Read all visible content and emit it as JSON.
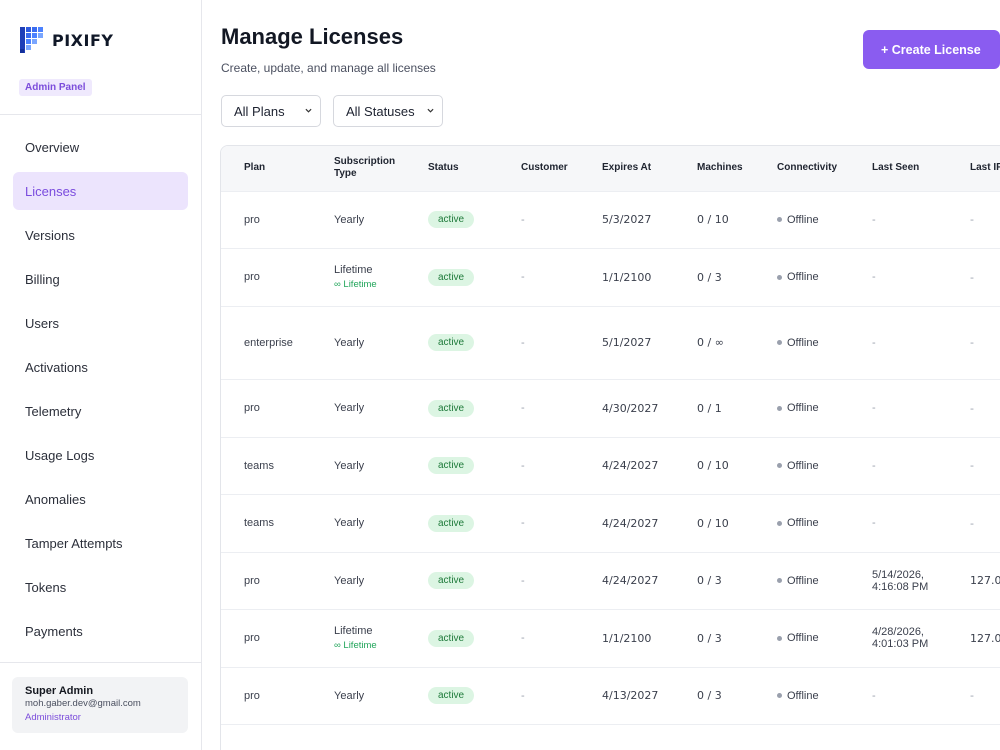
{
  "brand": {
    "name": "PIXIFY",
    "badge": "Admin Panel"
  },
  "nav": [
    "Overview",
    "Licenses",
    "Versions",
    "Billing",
    "Users",
    "Activations",
    "Telemetry",
    "Usage Logs",
    "Anomalies",
    "Tamper Attempts",
    "Tokens",
    "Payments"
  ],
  "active_nav": "Licenses",
  "user": {
    "name": "Super Admin",
    "email": "moh.gaber.dev@gmail.com",
    "role": "Administrator"
  },
  "header": {
    "title": "Manage Licenses",
    "subtitle": "Create, update, and manage all licenses",
    "create_label": "+ Create License"
  },
  "filters": {
    "plan": "All Plans",
    "status": "All Statuses"
  },
  "columns": [
    "Plan",
    "Subscription Type",
    "Status",
    "Customer",
    "Expires At",
    "Machines",
    "Connectivity",
    "Last Seen",
    "Last IP"
  ],
  "rows": [
    {
      "plan": "pro",
      "sub": "Yearly",
      "sub_note": "",
      "status": "active",
      "customer": "-",
      "expires": "5/3/2027",
      "machines": "0 / 10",
      "conn": "Offline",
      "seen1": "-",
      "seen2": "",
      "ip": "-"
    },
    {
      "plan": "pro",
      "sub": "Lifetime",
      "sub_note": "∞ Lifetime",
      "status": "active",
      "customer": "-",
      "expires": "1/1/2100",
      "machines": "0 / 3",
      "conn": "Offline",
      "seen1": "-",
      "seen2": "",
      "ip": "-"
    },
    {
      "plan": "enterprise",
      "sub": "Yearly",
      "sub_note": "",
      "status": "active",
      "customer": "-",
      "expires": "5/1/2027",
      "machines": "0 / ∞",
      "conn": "Offline",
      "seen1": "-",
      "seen2": "",
      "ip": "-"
    },
    {
      "plan": "pro",
      "sub": "Yearly",
      "sub_note": "",
      "status": "active",
      "customer": "-",
      "expires": "4/30/2027",
      "machines": "0 / 1",
      "conn": "Offline",
      "seen1": "-",
      "seen2": "",
      "ip": "-"
    },
    {
      "plan": "teams",
      "sub": "Yearly",
      "sub_note": "",
      "status": "active",
      "customer": "-",
      "expires": "4/24/2027",
      "machines": "0 / 10",
      "conn": "Offline",
      "seen1": "-",
      "seen2": "",
      "ip": "-"
    },
    {
      "plan": "teams",
      "sub": "Yearly",
      "sub_note": "",
      "status": "active",
      "customer": "-",
      "expires": "4/24/2027",
      "machines": "0 / 10",
      "conn": "Offline",
      "seen1": "-",
      "seen2": "",
      "ip": "-"
    },
    {
      "plan": "pro",
      "sub": "Yearly",
      "sub_note": "",
      "status": "active",
      "customer": "-",
      "expires": "4/24/2027",
      "machines": "0 / 3",
      "conn": "Offline",
      "seen1": "5/14/2026,",
      "seen2": "4:16:08 PM",
      "ip": "127.0"
    },
    {
      "plan": "pro",
      "sub": "Lifetime",
      "sub_note": "∞ Lifetime",
      "status": "active",
      "customer": "-",
      "expires": "1/1/2100",
      "machines": "0 / 3",
      "conn": "Offline",
      "seen1": "4/28/2026,",
      "seen2": "4:01:03 PM",
      "ip": "127.0"
    },
    {
      "plan": "pro",
      "sub": "Yearly",
      "sub_note": "",
      "status": "active",
      "customer": "-",
      "expires": "4/13/2027",
      "machines": "0 / 3",
      "conn": "Offline",
      "seen1": "-",
      "seen2": "",
      "ip": "-"
    }
  ],
  "row_heights": [
    57,
    58,
    73,
    58,
    57,
    58,
    57,
    58,
    57,
    40
  ],
  "colors": {
    "accent": "#8a5cf0",
    "active_bg": "#dcf5e3",
    "active_fg": "#1e7a3a"
  }
}
